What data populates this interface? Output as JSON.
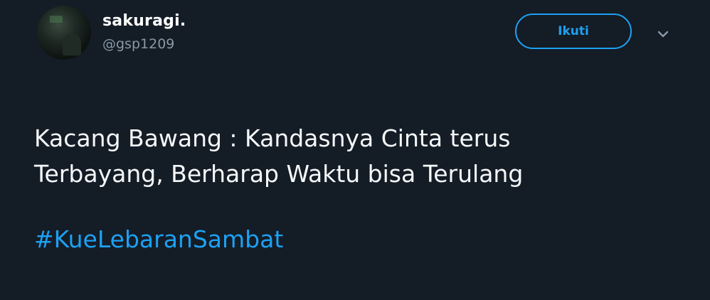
{
  "tweet": {
    "author": {
      "display_name": "sakuragi.",
      "handle": "@gsp1209"
    },
    "follow_label": "Ikuti",
    "text_lines": [
      "Kacang Bawang : Kandasnya Cinta terus",
      "Terbayang, Berharap Waktu bisa Terulang"
    ],
    "hashtag": "#KueLebaranSambat",
    "icons": {
      "avatar": "user-avatar",
      "menu": "chevron-down-icon"
    },
    "colors": {
      "background": "#141c26",
      "accent": "#1da1f2",
      "secondary_text": "#8899a6",
      "primary_text": "#f5f8fa"
    }
  }
}
